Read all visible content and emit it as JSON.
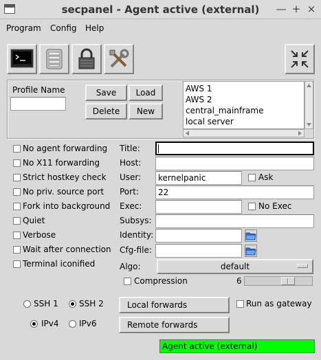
{
  "window": {
    "title": "secpanel - Agent active (external)",
    "controls": {
      "minimize": "—",
      "maximize": "+",
      "close": "×"
    }
  },
  "menu": [
    "Program",
    "Config",
    "Help"
  ],
  "toolbar": {
    "icons": [
      "terminal-icon",
      "document-stack-icon",
      "padlock-icon",
      "tools-icon",
      "collapse-icon"
    ]
  },
  "profile": {
    "name_label": "Profile Name",
    "name_value": "",
    "buttons": {
      "save": "Save",
      "load": "Load",
      "delete": "Delete",
      "new": "New"
    },
    "list": [
      "AWS 1",
      "AWS 2",
      "central_mainframe",
      "local server"
    ]
  },
  "options": [
    {
      "label": "No agent forwarding",
      "checked": false
    },
    {
      "label": "No X11 forwarding",
      "checked": false
    },
    {
      "label": "Strict hostkey check",
      "checked": false
    },
    {
      "label": "No priv. source port",
      "checked": false
    },
    {
      "label": "Fork into background",
      "checked": false
    },
    {
      "label": "Quiet",
      "checked": false
    },
    {
      "label": "Verbose",
      "checked": false
    },
    {
      "label": "Wait after connection",
      "checked": false
    },
    {
      "label": "Terminal iconified",
      "checked": false
    }
  ],
  "fields": {
    "title": {
      "label": "Title:",
      "value": ""
    },
    "host": {
      "label": "Host:",
      "value": ""
    },
    "user": {
      "label": "User:",
      "value": "kernelpanic"
    },
    "ask": {
      "label": "Ask",
      "checked": false
    },
    "port": {
      "label": "Port:",
      "value": "22"
    },
    "exec": {
      "label": "Exec:",
      "value": ""
    },
    "noexec": {
      "label": "No Exec",
      "checked": false
    },
    "subsys": {
      "label": "Subsys:",
      "value": ""
    },
    "identity": {
      "label": "Identity:",
      "value": ""
    },
    "cfgfile": {
      "label": "Cfg-file:",
      "value": ""
    },
    "algo": {
      "label": "Algo:",
      "value": "default"
    },
    "compression": {
      "label": "Compression",
      "checked": false,
      "level": "6"
    }
  },
  "ssh": {
    "ssh1": "SSH 1",
    "ssh2": "SSH 2",
    "selected_protocol": "SSH 2",
    "ipv4": "IPv4",
    "ipv6": "IPv6",
    "selected_ip": "IPv4"
  },
  "forwards": {
    "local": "Local forwards",
    "remote": "Remote forwards",
    "gateway": "Run as gateway",
    "gateway_checked": false
  },
  "status": {
    "text": "Agent active (external)",
    "color": "#00ff00"
  },
  "colors": {
    "background": "#d9d9d9",
    "status_bg": "#00ff00"
  }
}
